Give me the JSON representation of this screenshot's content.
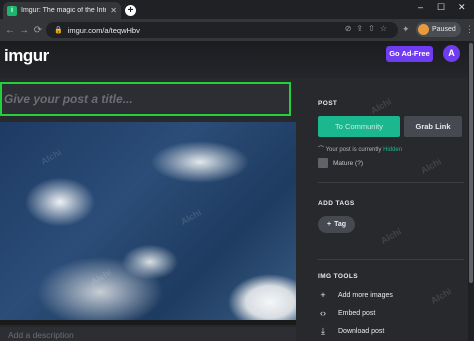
{
  "browser": {
    "tab_title": "Imgur: The magic of the Internet",
    "tab_favicon_letter": "i",
    "url": "imgur.com/a/teqwHbv",
    "profile_status": "Paused"
  },
  "header": {
    "logo": "imgur",
    "ad_free_label": "Go Ad-Free",
    "avatar_letter": "A"
  },
  "post": {
    "title_placeholder": "Give your post a title...",
    "description_placeholder": "Add a description"
  },
  "panel": {
    "post_heading": "POST",
    "community_label": "To Community",
    "grab_link_label": "Grab Link",
    "visibility_prefix": "Your post is currently",
    "visibility_value": "Hidden",
    "mature_label": "Mature (?)",
    "tags_heading": "ADD TAGS",
    "tag_label": "Tag",
    "tools_heading": "IMG TOOLS",
    "tools": [
      {
        "label": "Add more images",
        "icon": "plus-icon"
      },
      {
        "label": "Embed post",
        "icon": "code-icon"
      },
      {
        "label": "Download post",
        "icon": "download-icon"
      }
    ]
  },
  "colors": {
    "accent_green": "#1bb78e",
    "ad_free_purple": "#6f3cf2",
    "focus_outline": "#21d03a"
  }
}
